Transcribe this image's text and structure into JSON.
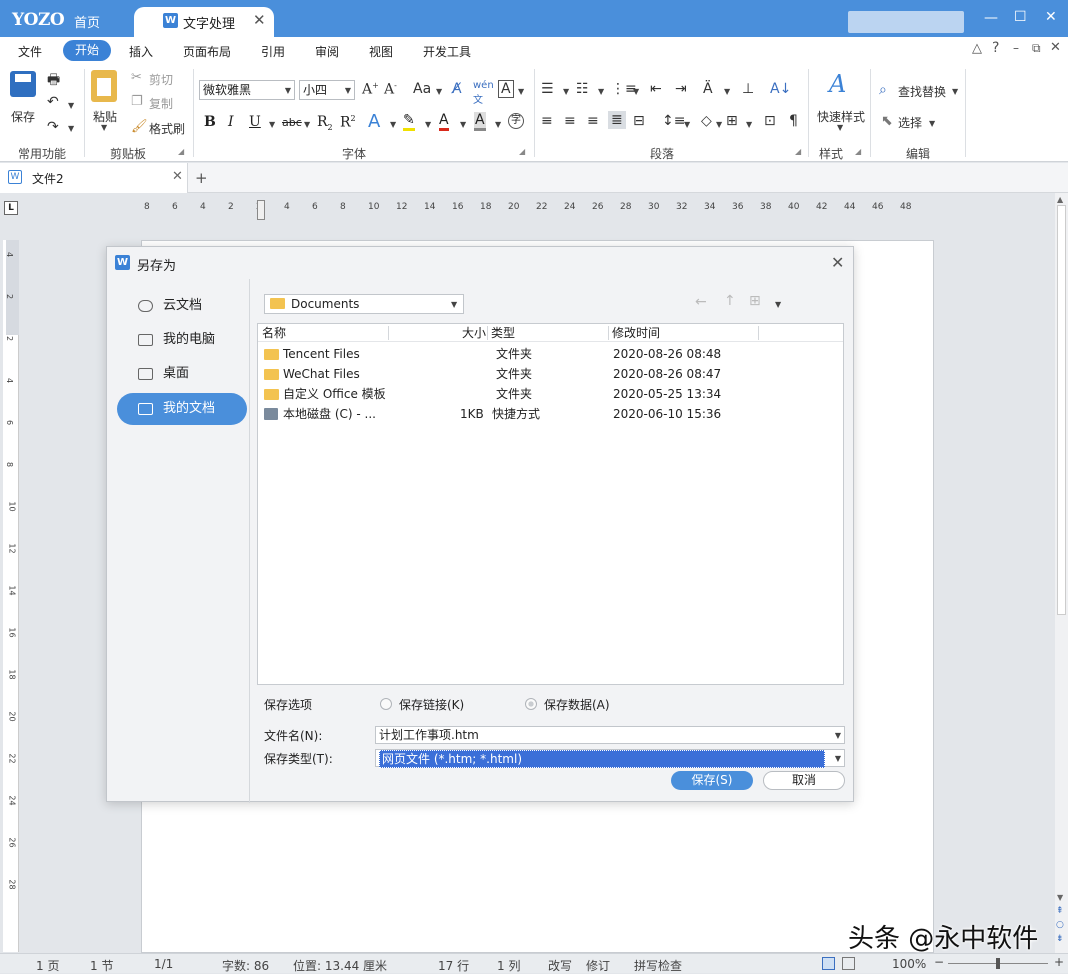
{
  "titlebar": {
    "logo": "YOZO",
    "home": "首页",
    "doc_tab": "文字处理",
    "doc_tab_icon": "W"
  },
  "menu": [
    "文件",
    "开始",
    "插入",
    "页面布局",
    "引用",
    "审阅",
    "视图",
    "开发工具"
  ],
  "ribbon": {
    "common": {
      "save": "保存",
      "label": "常用功能"
    },
    "clipboard": {
      "paste": "粘贴",
      "cut": "剪切",
      "copy": "复制",
      "format_painter": "格式刷",
      "label": "剪贴板"
    },
    "font": {
      "name": "微软雅黑",
      "size": "小四",
      "label": "字体"
    },
    "paragraph": {
      "label": "段落"
    },
    "styles": {
      "quick": "快速样式",
      "label": "样式"
    },
    "edit": {
      "find": "查找替换",
      "select": "选择",
      "label": "编辑"
    }
  },
  "doc_tabs": {
    "file": "文件2",
    "add": "+"
  },
  "ruler": {
    "h": [
      "8",
      "6",
      "4",
      "2",
      "2",
      "4",
      "6",
      "8",
      "10",
      "12",
      "14",
      "16",
      "18",
      "20",
      "22",
      "24",
      "26",
      "28",
      "30",
      "32",
      "34",
      "36",
      "38",
      "40",
      "42",
      "44",
      "46",
      "48"
    ],
    "v": [
      "4",
      "2",
      "2",
      "4",
      "6",
      "8",
      "10",
      "12",
      "14",
      "16",
      "18",
      "20",
      "22",
      "24",
      "26",
      "28"
    ]
  },
  "dialog": {
    "title": "另存为",
    "nav": [
      {
        "label": "云文档"
      },
      {
        "label": "我的电脑"
      },
      {
        "label": "桌面"
      },
      {
        "label": "我的文档"
      }
    ],
    "selected_nav": "我的文档",
    "path": "Documents",
    "columns": [
      "名称",
      "大小",
      "类型",
      "修改时间"
    ],
    "files": [
      {
        "name": "Tencent Files",
        "size": "",
        "type": "文件夹",
        "modified": "2020-08-26 08:48"
      },
      {
        "name": "WeChat Files",
        "size": "",
        "type": "文件夹",
        "modified": "2020-08-26 08:47"
      },
      {
        "name": "自定义 Office 模板",
        "size": "",
        "type": "文件夹",
        "modified": "2020-05-25 13:34"
      },
      {
        "name": "本地磁盘 (C) - ...",
        "size": "1KB",
        "type": "快捷方式",
        "modified": "2020-06-10 15:36"
      }
    ],
    "save_options_label": "保存选项",
    "opt_link": "保存链接(K)",
    "opt_data": "保存数据(A)",
    "filename_label": "文件名(N):",
    "filename": "计划工作事项.htm",
    "filetype_label": "保存类型(T):",
    "filetype": "网页文件 (*.htm; *.html)",
    "save_btn": "保存(S)",
    "cancel_btn": "取消"
  },
  "status": {
    "page": "1 页",
    "section": "1 节",
    "pages": "1/1",
    "words": "字数: 86",
    "position": "位置: 13.44 厘米",
    "row": "17 行",
    "col": "1 列",
    "overwrite": "改写",
    "revise": "修订",
    "spell": "拼写检查",
    "zoom": "100%"
  },
  "watermark": "头条 @永中软件",
  "colors": {
    "accent": "#4a8fdb",
    "selected_field": "#3b6fd8"
  }
}
